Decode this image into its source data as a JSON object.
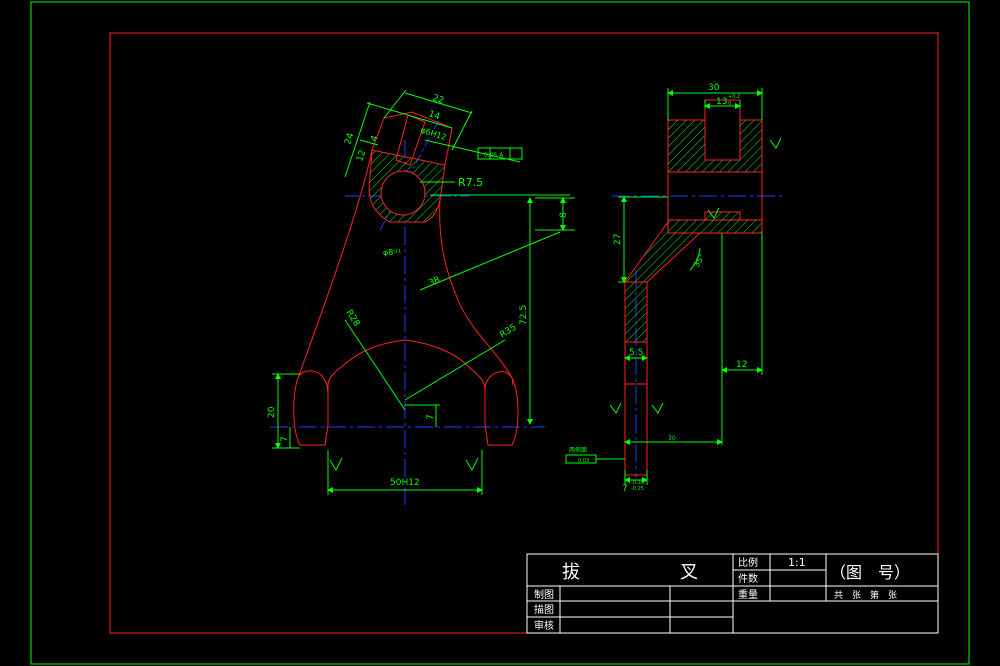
{
  "colors": {
    "background": "#000000",
    "outer_frame": "#00ff00",
    "inner_frame": "#ff2020",
    "part_outline": "#ff2020",
    "dimension": "#00ff00",
    "centerline": "#1e3cff",
    "hatch": "#00ff00",
    "title_text": "#ffffff"
  },
  "front_view": {
    "dims": {
      "d22": "22",
      "d14": "14",
      "d24": "24",
      "d12": "12",
      "d4": "4",
      "phi_h12": "φ6H12",
      "tol_box": "0.05 A",
      "r75": "R7.5",
      "d8": "8",
      "phi_11": "φ8ⁱ¹¹",
      "d38": "38",
      "r28": "R28",
      "r35": "R35",
      "d725": "72.5",
      "d20": "20",
      "d7a": "7",
      "d7b": "7",
      "d50h12": "50H12"
    }
  },
  "side_view": {
    "dims": {
      "d30top": "30",
      "d13": "13",
      "d13sup": "+0.2",
      "d13sub": "0",
      "d27": "27",
      "d35": "35°",
      "d55": "5.5",
      "d12": "12",
      "d30bot": "30",
      "d7": "7",
      "d7sup": "-0.15",
      "d7sub": "-0.25",
      "note_label": "两侧面",
      "note_box": "0.03"
    }
  },
  "title_block": {
    "part_name_1": "拔",
    "part_name_2": "叉",
    "scale_label": "比例",
    "scale_value": "1:1",
    "qty_label": "件数",
    "weight_label": "重量",
    "drawing_no": "（图　号）",
    "sheets": "共　张　第　张",
    "drawn_by": "制图",
    "traced_by": "描图",
    "checked_by": "审核"
  }
}
